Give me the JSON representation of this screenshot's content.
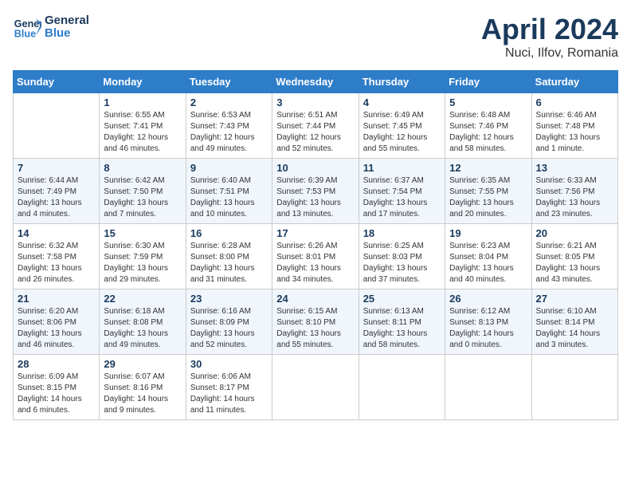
{
  "header": {
    "logo_line1": "General",
    "logo_line2": "Blue",
    "title": "April 2024",
    "location": "Nuci, Ilfov, Romania"
  },
  "weekdays": [
    "Sunday",
    "Monday",
    "Tuesday",
    "Wednesday",
    "Thursday",
    "Friday",
    "Saturday"
  ],
  "weeks": [
    [
      {
        "day": "",
        "sunrise": "",
        "sunset": "",
        "daylight": ""
      },
      {
        "day": "1",
        "sunrise": "Sunrise: 6:55 AM",
        "sunset": "Sunset: 7:41 PM",
        "daylight": "Daylight: 12 hours and 46 minutes."
      },
      {
        "day": "2",
        "sunrise": "Sunrise: 6:53 AM",
        "sunset": "Sunset: 7:43 PM",
        "daylight": "Daylight: 12 hours and 49 minutes."
      },
      {
        "day": "3",
        "sunrise": "Sunrise: 6:51 AM",
        "sunset": "Sunset: 7:44 PM",
        "daylight": "Daylight: 12 hours and 52 minutes."
      },
      {
        "day": "4",
        "sunrise": "Sunrise: 6:49 AM",
        "sunset": "Sunset: 7:45 PM",
        "daylight": "Daylight: 12 hours and 55 minutes."
      },
      {
        "day": "5",
        "sunrise": "Sunrise: 6:48 AM",
        "sunset": "Sunset: 7:46 PM",
        "daylight": "Daylight: 12 hours and 58 minutes."
      },
      {
        "day": "6",
        "sunrise": "Sunrise: 6:46 AM",
        "sunset": "Sunset: 7:48 PM",
        "daylight": "Daylight: 13 hours and 1 minute."
      }
    ],
    [
      {
        "day": "7",
        "sunrise": "Sunrise: 6:44 AM",
        "sunset": "Sunset: 7:49 PM",
        "daylight": "Daylight: 13 hours and 4 minutes."
      },
      {
        "day": "8",
        "sunrise": "Sunrise: 6:42 AM",
        "sunset": "Sunset: 7:50 PM",
        "daylight": "Daylight: 13 hours and 7 minutes."
      },
      {
        "day": "9",
        "sunrise": "Sunrise: 6:40 AM",
        "sunset": "Sunset: 7:51 PM",
        "daylight": "Daylight: 13 hours and 10 minutes."
      },
      {
        "day": "10",
        "sunrise": "Sunrise: 6:39 AM",
        "sunset": "Sunset: 7:53 PM",
        "daylight": "Daylight: 13 hours and 13 minutes."
      },
      {
        "day": "11",
        "sunrise": "Sunrise: 6:37 AM",
        "sunset": "Sunset: 7:54 PM",
        "daylight": "Daylight: 13 hours and 17 minutes."
      },
      {
        "day": "12",
        "sunrise": "Sunrise: 6:35 AM",
        "sunset": "Sunset: 7:55 PM",
        "daylight": "Daylight: 13 hours and 20 minutes."
      },
      {
        "day": "13",
        "sunrise": "Sunrise: 6:33 AM",
        "sunset": "Sunset: 7:56 PM",
        "daylight": "Daylight: 13 hours and 23 minutes."
      }
    ],
    [
      {
        "day": "14",
        "sunrise": "Sunrise: 6:32 AM",
        "sunset": "Sunset: 7:58 PM",
        "daylight": "Daylight: 13 hours and 26 minutes."
      },
      {
        "day": "15",
        "sunrise": "Sunrise: 6:30 AM",
        "sunset": "Sunset: 7:59 PM",
        "daylight": "Daylight: 13 hours and 29 minutes."
      },
      {
        "day": "16",
        "sunrise": "Sunrise: 6:28 AM",
        "sunset": "Sunset: 8:00 PM",
        "daylight": "Daylight: 13 hours and 31 minutes."
      },
      {
        "day": "17",
        "sunrise": "Sunrise: 6:26 AM",
        "sunset": "Sunset: 8:01 PM",
        "daylight": "Daylight: 13 hours and 34 minutes."
      },
      {
        "day": "18",
        "sunrise": "Sunrise: 6:25 AM",
        "sunset": "Sunset: 8:03 PM",
        "daylight": "Daylight: 13 hours and 37 minutes."
      },
      {
        "day": "19",
        "sunrise": "Sunrise: 6:23 AM",
        "sunset": "Sunset: 8:04 PM",
        "daylight": "Daylight: 13 hours and 40 minutes."
      },
      {
        "day": "20",
        "sunrise": "Sunrise: 6:21 AM",
        "sunset": "Sunset: 8:05 PM",
        "daylight": "Daylight: 13 hours and 43 minutes."
      }
    ],
    [
      {
        "day": "21",
        "sunrise": "Sunrise: 6:20 AM",
        "sunset": "Sunset: 8:06 PM",
        "daylight": "Daylight: 13 hours and 46 minutes."
      },
      {
        "day": "22",
        "sunrise": "Sunrise: 6:18 AM",
        "sunset": "Sunset: 8:08 PM",
        "daylight": "Daylight: 13 hours and 49 minutes."
      },
      {
        "day": "23",
        "sunrise": "Sunrise: 6:16 AM",
        "sunset": "Sunset: 8:09 PM",
        "daylight": "Daylight: 13 hours and 52 minutes."
      },
      {
        "day": "24",
        "sunrise": "Sunrise: 6:15 AM",
        "sunset": "Sunset: 8:10 PM",
        "daylight": "Daylight: 13 hours and 55 minutes."
      },
      {
        "day": "25",
        "sunrise": "Sunrise: 6:13 AM",
        "sunset": "Sunset: 8:11 PM",
        "daylight": "Daylight: 13 hours and 58 minutes."
      },
      {
        "day": "26",
        "sunrise": "Sunrise: 6:12 AM",
        "sunset": "Sunset: 8:13 PM",
        "daylight": "Daylight: 14 hours and 0 minutes."
      },
      {
        "day": "27",
        "sunrise": "Sunrise: 6:10 AM",
        "sunset": "Sunset: 8:14 PM",
        "daylight": "Daylight: 14 hours and 3 minutes."
      }
    ],
    [
      {
        "day": "28",
        "sunrise": "Sunrise: 6:09 AM",
        "sunset": "Sunset: 8:15 PM",
        "daylight": "Daylight: 14 hours and 6 minutes."
      },
      {
        "day": "29",
        "sunrise": "Sunrise: 6:07 AM",
        "sunset": "Sunset: 8:16 PM",
        "daylight": "Daylight: 14 hours and 9 minutes."
      },
      {
        "day": "30",
        "sunrise": "Sunrise: 6:06 AM",
        "sunset": "Sunset: 8:17 PM",
        "daylight": "Daylight: 14 hours and 11 minutes."
      },
      {
        "day": "",
        "sunrise": "",
        "sunset": "",
        "daylight": ""
      },
      {
        "day": "",
        "sunrise": "",
        "sunset": "",
        "daylight": ""
      },
      {
        "day": "",
        "sunrise": "",
        "sunset": "",
        "daylight": ""
      },
      {
        "day": "",
        "sunrise": "",
        "sunset": "",
        "daylight": ""
      }
    ]
  ]
}
